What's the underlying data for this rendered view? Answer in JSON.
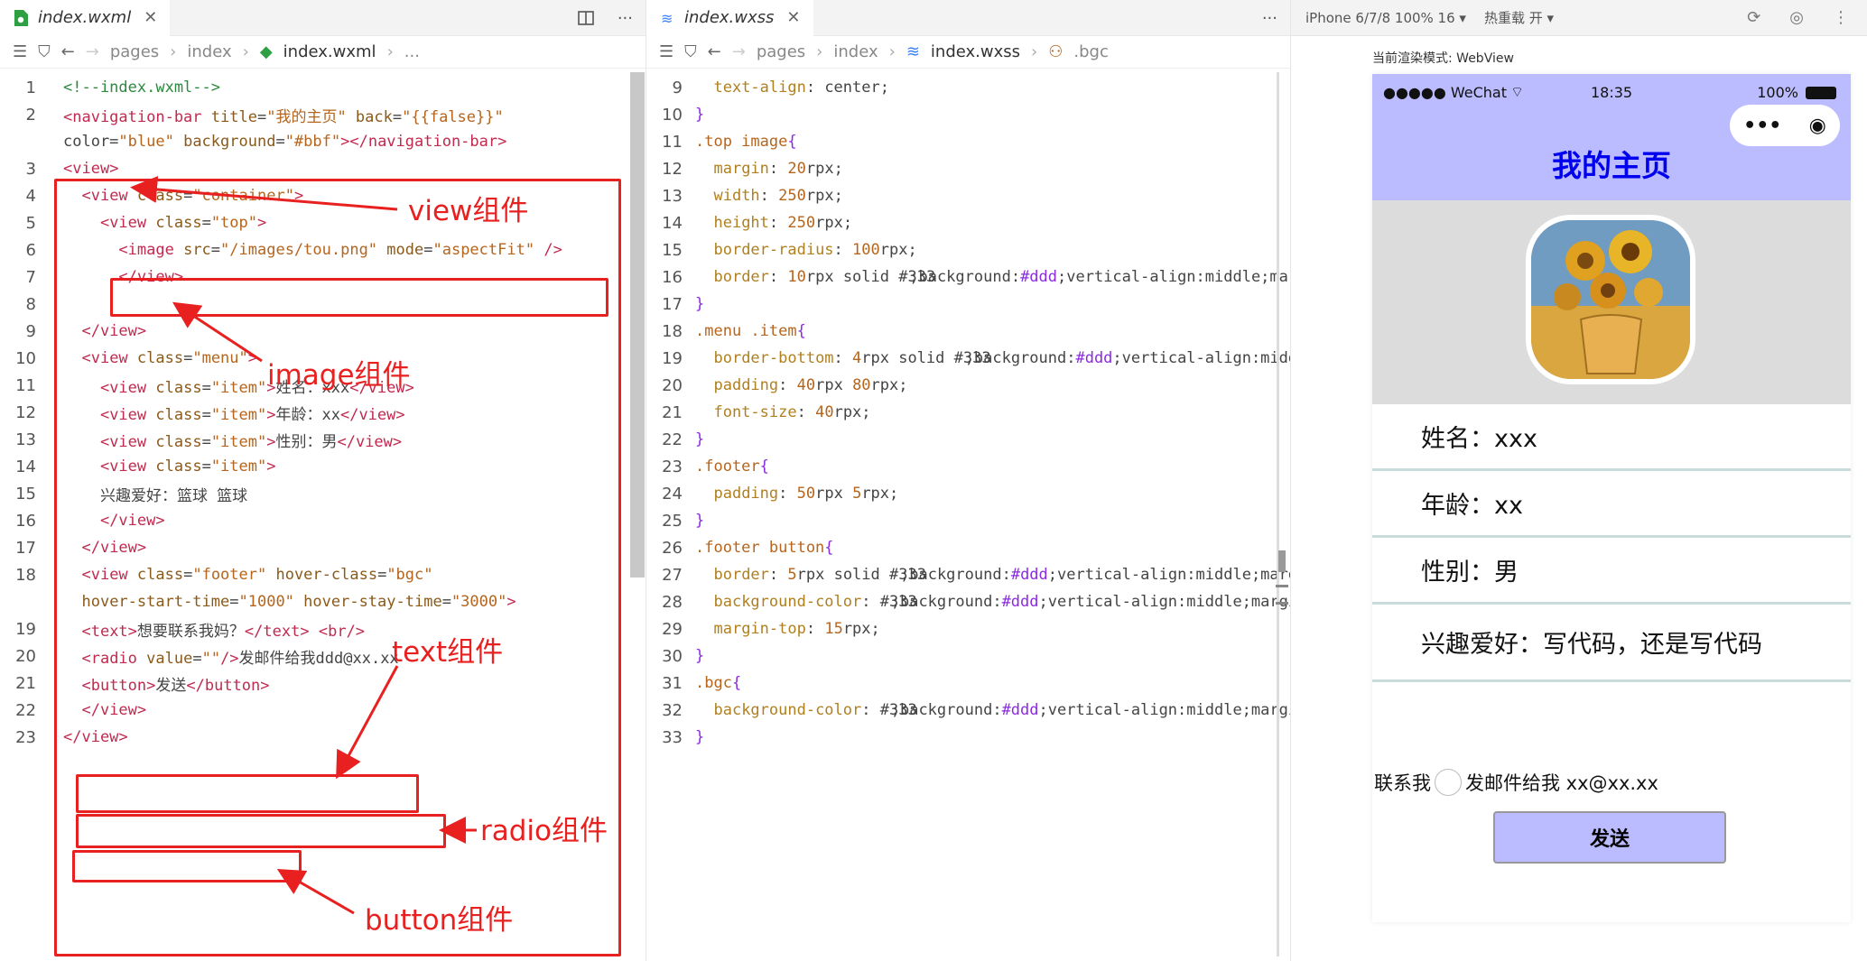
{
  "wxml_tab": {
    "name": "index.wxml",
    "close": "✕"
  },
  "wxml_breadcrumb": [
    "pages",
    "index",
    "index.wxml",
    "..."
  ],
  "wxss_tab": {
    "name": "index.wxss",
    "close": "✕"
  },
  "wxss_breadcrumb": [
    "pages",
    "index",
    "index.wxss",
    ".bgc"
  ],
  "more": "···",
  "wxml_lines": [
    {
      "n": "1",
      "t": "<!--index.wxml-->"
    },
    {
      "n": "2",
      "t": "<navigation-bar title=\"我的主页\" back=\"{{false}}\""
    },
    {
      "n": "",
      "t": "color=\"blue\" background=\"#bbf\"></navigation-bar>"
    },
    {
      "n": "3",
      "t": "<view>"
    },
    {
      "n": "4",
      "t": "  <view class=\"container\">"
    },
    {
      "n": "5",
      "t": "    <view class=\"top\">"
    },
    {
      "n": "6",
      "t": "      <image src=\"/images/tou.png\" mode=\"aspectFit\" />"
    },
    {
      "n": "7",
      "t": "      </view>"
    },
    {
      "n": "8",
      "t": ""
    },
    {
      "n": "9",
      "t": "  </view>"
    },
    {
      "n": "10",
      "t": "  <view class=\"menu\">"
    },
    {
      "n": "11",
      "t": "    <view class=\"item\">姓名：xxx</view>"
    },
    {
      "n": "12",
      "t": "    <view class=\"item\">年龄：xx</view>"
    },
    {
      "n": "13",
      "t": "    <view class=\"item\">性别：男</view>"
    },
    {
      "n": "14",
      "t": "    <view class=\"item\">"
    },
    {
      "n": "15",
      "t": "    兴趣爱好：篮球 篮球"
    },
    {
      "n": "16",
      "t": "    </view>"
    },
    {
      "n": "17",
      "t": "  </view>"
    },
    {
      "n": "18",
      "t": "  <view class=\"footer\" hover-class=\"bgc\""
    },
    {
      "n": "",
      "t": "  hover-start-time=\"1000\" hover-stay-time=\"3000\">"
    },
    {
      "n": "19",
      "t": "  <text>想要联系我妈？</text> <br/>"
    },
    {
      "n": "20",
      "t": "  <radio value=\"\"/>发邮件给我ddd@xx.xx"
    },
    {
      "n": "21",
      "t": "  <button>发送</button>"
    },
    {
      "n": "22",
      "t": "  </view>"
    },
    {
      "n": "23",
      "t": "</view>"
    }
  ],
  "wxss_lines": [
    {
      "n": "9",
      "t": "  text-align: center;"
    },
    {
      "n": "10",
      "t": "}"
    },
    {
      "n": "11",
      "t": ".top image{"
    },
    {
      "n": "12",
      "t": "  margin: 20rpx;"
    },
    {
      "n": "13",
      "t": "  width: 250rpx;"
    },
    {
      "n": "14",
      "t": "  height: 250rpx;"
    },
    {
      "n": "15",
      "t": "  border-radius: 100rpx;"
    },
    {
      "n": "16",
      "t": "  border: 10rpx solid ■#fff;"
    },
    {
      "n": "17",
      "t": "}"
    },
    {
      "n": "18",
      "t": ".menu .item{"
    },
    {
      "n": "19",
      "t": "  border-bottom: 4rpx solid ■#cdd;"
    },
    {
      "n": "20",
      "t": "  padding: 40rpx 80rpx;"
    },
    {
      "n": "21",
      "t": "  font-size: 40rpx;"
    },
    {
      "n": "22",
      "t": "}"
    },
    {
      "n": "23",
      "t": ".footer{"
    },
    {
      "n": "24",
      "t": "  padding: 50rpx 5rpx;"
    },
    {
      "n": "25",
      "t": "}"
    },
    {
      "n": "26",
      "t": ".footer button{"
    },
    {
      "n": "27",
      "t": "  border: 5rpx solid ■#aaa;"
    },
    {
      "n": "28",
      "t": "  background-color: ■#bbf;"
    },
    {
      "n": "29",
      "t": "  margin-top: 15rpx;"
    },
    {
      "n": "30",
      "t": "}"
    },
    {
      "n": "31",
      "t": ".bgc{"
    },
    {
      "n": "32",
      "t": "  background-color: ■#cdd;"
    },
    {
      "n": "33",
      "t": "}"
    }
  ],
  "annotations": {
    "view": "view组件",
    "image": "image组件",
    "text": "text组件",
    "radio": "radio组件",
    "button": "button组件"
  },
  "device": {
    "model": "iPhone 6/7/8 100% 16 ▾",
    "hot": "热重载 开 ▾",
    "mode": "当前渲染模式: WebView"
  },
  "phone": {
    "carrier": "●●●●● WeChat",
    "time": "18:35",
    "battery": "100%",
    "title": "我的主页",
    "capsule_more": "•••",
    "capsule_close": "◉"
  },
  "menu_items": [
    "姓名：xxx",
    "年龄：xx",
    "性别：男",
    "兴趣爱好：写代码，还是写代码"
  ],
  "footer": {
    "text": "联系我",
    "radio_label": "发邮件给我 xx@xx.xx",
    "button": "发送"
  },
  "colors": {
    "nav_bg": "#bbbbff",
    "nav_title": "#0000ee",
    "annotation": "#e8201f",
    "divider": "#c9dcdc"
  }
}
